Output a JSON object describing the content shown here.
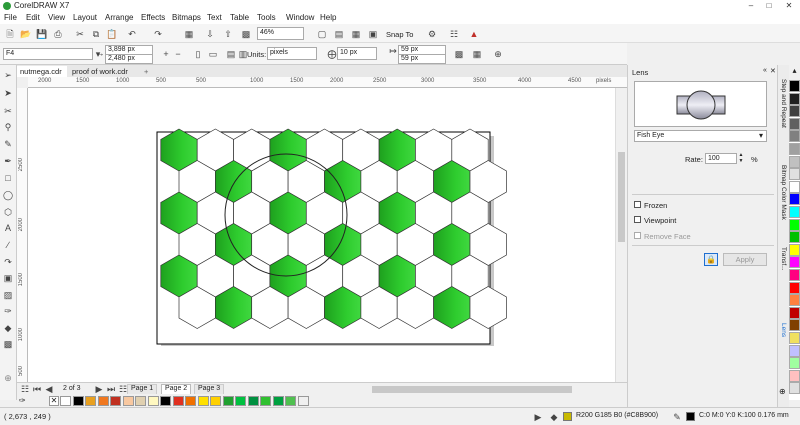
{
  "app": {
    "title": "CorelDRAW X7"
  },
  "menu": [
    "File",
    "Edit",
    "View",
    "Layout",
    "Arrange",
    "Effects",
    "Bitmaps",
    "Text",
    "Table",
    "Tools",
    "Window",
    "Help"
  ],
  "toolbar": {
    "zoom": "46%",
    "snap_label": "Snap To",
    "preset": "F4"
  },
  "props": {
    "width": "3,898 px",
    "height": "2,480 px",
    "units_label": "Units:",
    "units": "pixels",
    "nudge": "10 px",
    "dup_x": "59 px",
    "dup_y": "59 px"
  },
  "doc_tabs": [
    "nutmega.cdr",
    "proof of work.cdr"
  ],
  "ruler_h": [
    "2000",
    "1500",
    "1000",
    "500",
    "0",
    "500",
    "1000",
    "1500",
    "2000",
    "2500",
    "3000",
    "3500",
    "4000",
    "4500",
    "pixels"
  ],
  "ruler_v": [
    "2500",
    "2000",
    "1500",
    "1000",
    "500"
  ],
  "pages": {
    "counter": "2 of 3",
    "tabs": [
      "Page 1",
      "Page 2",
      "Page 3"
    ]
  },
  "status": {
    "coords": "( 2,673 , 249 )",
    "fill_label": "R200 G185 B0 (#C8B900)",
    "outline_label": "C:0 M:0 Y:0 K:100  0.176 mm",
    "fill_color": "#C8B900",
    "outline_color": "#000000"
  },
  "lens": {
    "panel_title": "Lens",
    "type": "Fish Eye",
    "rate_label": "Rate:",
    "rate": "100",
    "rate_unit": "%",
    "frozen_label": "Frozen",
    "viewpoint_label": "Viewpoint",
    "remove_face_label": "Remove Face",
    "apply_label": "Apply"
  },
  "side_tabs": [
    "Step and Repeat",
    "Bitmap Color Mask",
    "Transf...",
    "Lens"
  ],
  "colors": {
    "hex_green": "#2ecc2e",
    "accent": "#1e6fd0"
  },
  "palette_h": [
    "#ffffff",
    "#000000",
    "#e8a020",
    "#f07820",
    "#c03020",
    "#f8c8a0",
    "#e0d0b0",
    "#fff8c0",
    "#000000",
    "#e03020",
    "#f07000",
    "#ffe000",
    "#ffd000",
    "#20a030",
    "#00c040",
    "#009040",
    "#30c030",
    "#00a040",
    "#50c050",
    "#f0f0f0"
  ],
  "palette_v": [
    "#000000",
    "#202020",
    "#404040",
    "#606060",
    "#808080",
    "#a0a0a0",
    "#c0c0c0",
    "#e0e0e0",
    "#ffffff",
    "#0000ff",
    "#00ffff",
    "#00ff00",
    "#00c000",
    "#ffff00",
    "#ff00ff",
    "#ff0080",
    "#ff0000",
    "#ff8040",
    "#c00000",
    "#804000",
    "#f0e060",
    "#c0c0ff",
    "#a0ffa0",
    "#ffc0c0",
    "#e0e0e0"
  ]
}
